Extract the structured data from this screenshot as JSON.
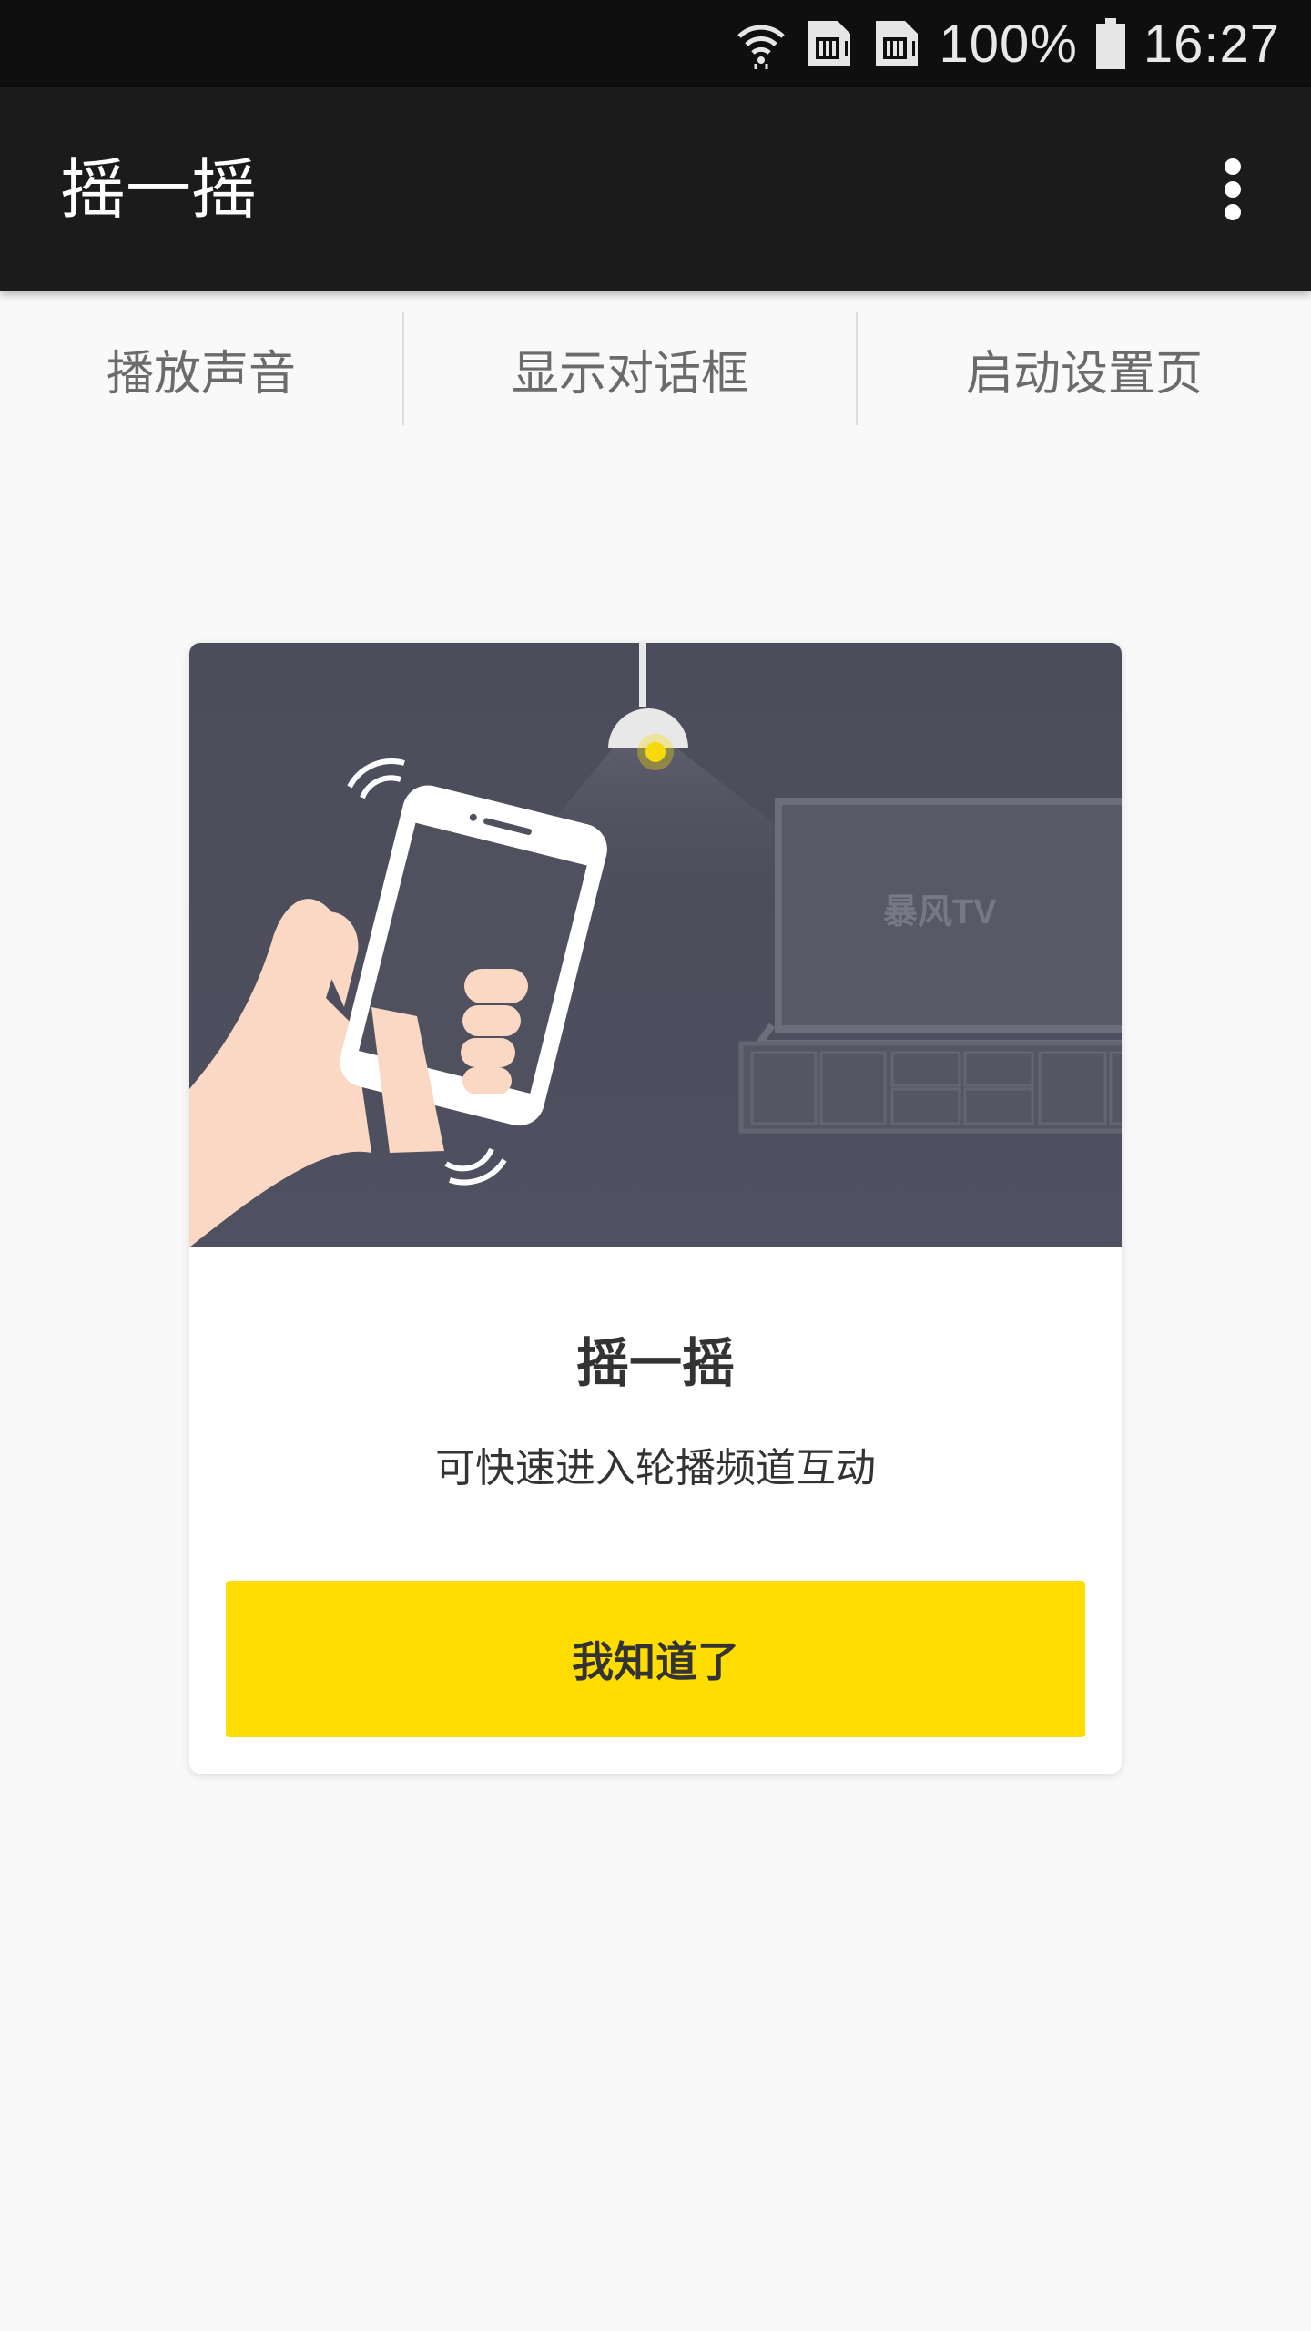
{
  "status_bar": {
    "battery": "100%",
    "time": "16:27",
    "icons": [
      "wifi-icon",
      "sim1-icon",
      "sim2-icon",
      "battery-icon"
    ]
  },
  "app_bar": {
    "title": "摇一摇",
    "more_icon": "more-vert-icon"
  },
  "tabs": [
    {
      "label": "播放声音"
    },
    {
      "label": "显示对话框"
    },
    {
      "label": "启动设置页"
    }
  ],
  "dialog": {
    "illustration_brand": "暴风TV",
    "title": "摇一摇",
    "description": "可快速进入轮播频道互动",
    "confirm_label": "我知道了"
  },
  "colors": {
    "status_bar": "#0f0f0f",
    "app_bar": "#1b1b1b",
    "background": "#f9f9f9",
    "accent_button": "#ffdd00",
    "illustration_bg": "#50515f"
  }
}
